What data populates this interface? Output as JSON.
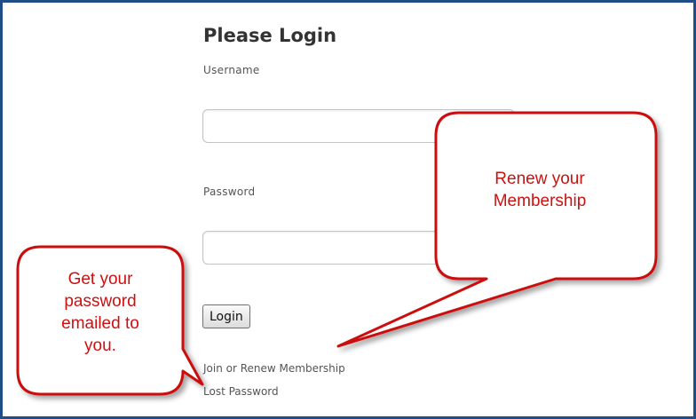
{
  "login_form": {
    "title": "Please Login",
    "username_label": "Username",
    "username_value": "",
    "password_label": "Password",
    "password_value": "",
    "login_button": "Login",
    "links": {
      "join_renew": "Join or Renew Membership",
      "lost_password": "Lost Password"
    }
  },
  "callouts": {
    "renew": {
      "line1": "Renew your",
      "line2": "Membership"
    },
    "password": {
      "line1": "Get your",
      "line2": "password",
      "line3": "emailed to",
      "line4": "you."
    }
  },
  "colors": {
    "frame_border": "#1f4e86",
    "callout_border": "#cc1111",
    "callout_text": "#cc1111"
  }
}
